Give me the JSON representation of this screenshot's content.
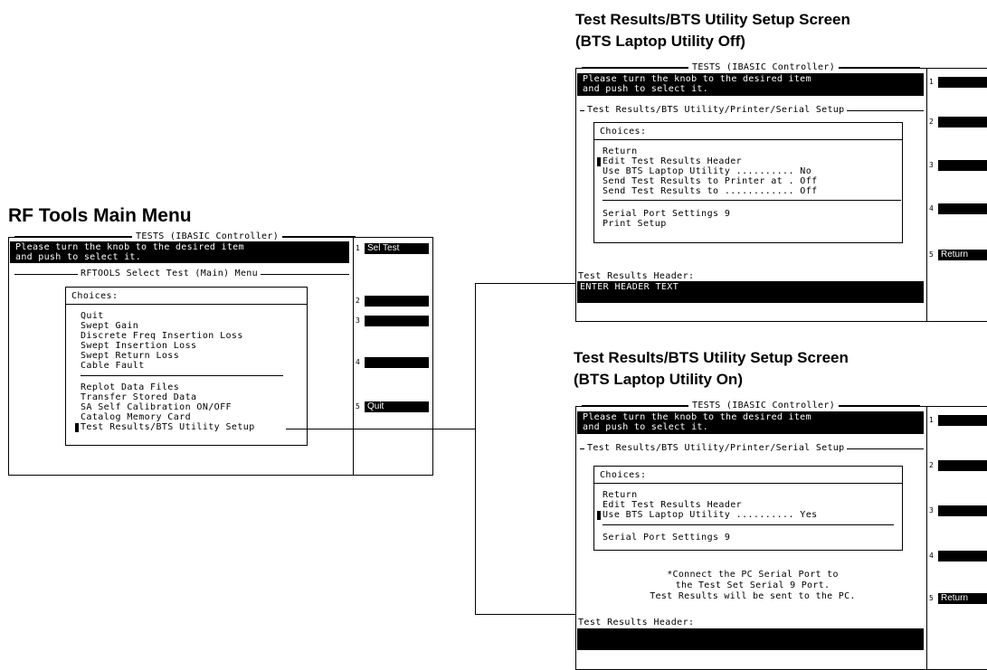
{
  "captions": {
    "main": "RF Tools Main Menu",
    "off_line1": "Test Results/BTS Utility Setup Screen",
    "off_line2": "(BTS Laptop Utility Off)",
    "on_line1": "Test Results/BTS Utility Setup Screen",
    "on_line2": "(BTS Laptop Utility On)"
  },
  "screens": {
    "main": {
      "title": "TESTS (IBASIC Controller)",
      "prompt": "Please turn the knob to the desired item\nand push to select it.",
      "panel_title": "RFTOOLS Select Test (Main) Menu",
      "choices_header": "Choices:",
      "items_group1": [
        "Quit",
        "Swept Gain",
        "Discrete Freq Insertion Loss",
        "Swept Insertion Loss",
        "Swept Return Loss",
        "Cable Fault"
      ],
      "items_group2": [
        "Replot Data Files",
        "Transfer Stored Data",
        "SA Self Calibration ON/OFF",
        "Catalog Memory Card",
        "Test Results/BTS Utility Setup"
      ],
      "softkeys": [
        {
          "num": "1",
          "label": "Sel Test"
        },
        {
          "num": "2",
          "label": ""
        },
        {
          "num": "3",
          "label": ""
        },
        {
          "num": "4",
          "label": ""
        },
        {
          "num": "5",
          "label": "Quit"
        }
      ]
    },
    "off": {
      "title": "TESTS (IBASIC Controller)",
      "prompt": "Please turn the knob to the desired item\nand push to select it.",
      "panel_title": "Test Results/BTS Utility/Printer/Serial Setup",
      "choices_header": "Choices:",
      "items_group1": [
        "Return",
        "Edit Test Results Header",
        "Use BTS Laptop Utility .......... No",
        "Send Test Results to Printer at . Off",
        "Send Test Results to ............ Off"
      ],
      "items_group2": [
        "Serial Port Settings 9",
        "Print Setup"
      ],
      "field_label": "Test Results Header:",
      "field_value": "ENTER HEADER TEXT",
      "softkeys": [
        {
          "num": "1",
          "label": ""
        },
        {
          "num": "2",
          "label": ""
        },
        {
          "num": "3",
          "label": ""
        },
        {
          "num": "4",
          "label": ""
        },
        {
          "num": "5",
          "label": "Return"
        }
      ]
    },
    "on": {
      "title": "TESTS (IBASIC Controller)",
      "prompt": "Please turn the knob to the desired item\nand push to select it.",
      "panel_title": "Test Results/BTS Utility/Printer/Serial Setup",
      "choices_header": "Choices:",
      "items_group1": [
        "Return",
        "Edit Test Results Header",
        "Use BTS Laptop Utility .......... Yes"
      ],
      "items_group2": [
        "Serial Port Settings 9"
      ],
      "note": "*Connect the PC Serial Port to\nthe Test Set Serial 9 Port.\nTest Results will be sent to the PC.",
      "field_label": "Test Results Header:",
      "field_value": "",
      "softkeys": [
        {
          "num": "1",
          "label": ""
        },
        {
          "num": "2",
          "label": ""
        },
        {
          "num": "3",
          "label": ""
        },
        {
          "num": "4",
          "label": ""
        },
        {
          "num": "5",
          "label": "Return"
        }
      ]
    }
  }
}
